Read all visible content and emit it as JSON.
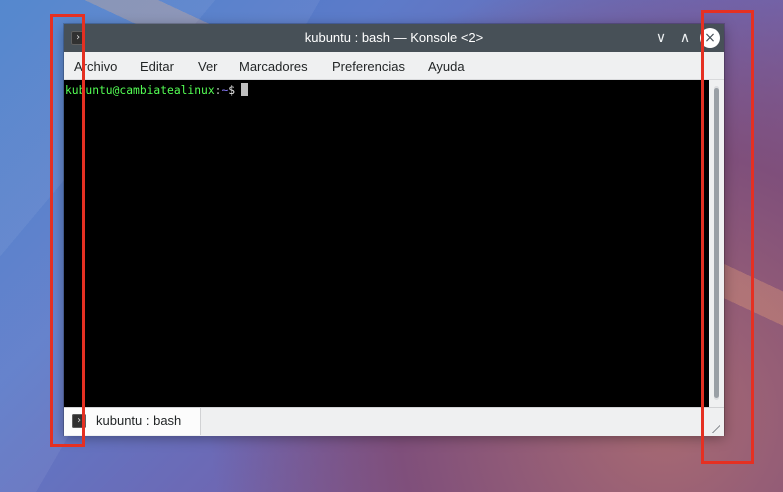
{
  "window": {
    "title": "kubuntu : bash — Konsole <2>",
    "app_icon": "terminal-icon",
    "buttons": {
      "minimize_glyph": "∨",
      "maximize_glyph": "∧",
      "close_glyph": "×"
    }
  },
  "menubar": {
    "items": [
      "Archivo",
      "Editar",
      "Ver",
      "Marcadores",
      "Preferencias",
      "Ayuda"
    ]
  },
  "terminal": {
    "prompt": {
      "user_host": "kubuntu@cambiatealinux",
      "separator": ":",
      "path": "~",
      "symbol": "$"
    },
    "colors": {
      "background": "#000000",
      "user_host": "#54ff54",
      "path": "#8b7cff",
      "cursor": "#bfbfbf"
    }
  },
  "tabs": [
    {
      "label": "kubuntu : bash",
      "icon": "terminal-icon"
    }
  ],
  "annotations": {
    "highlight_color": "#e53022"
  }
}
